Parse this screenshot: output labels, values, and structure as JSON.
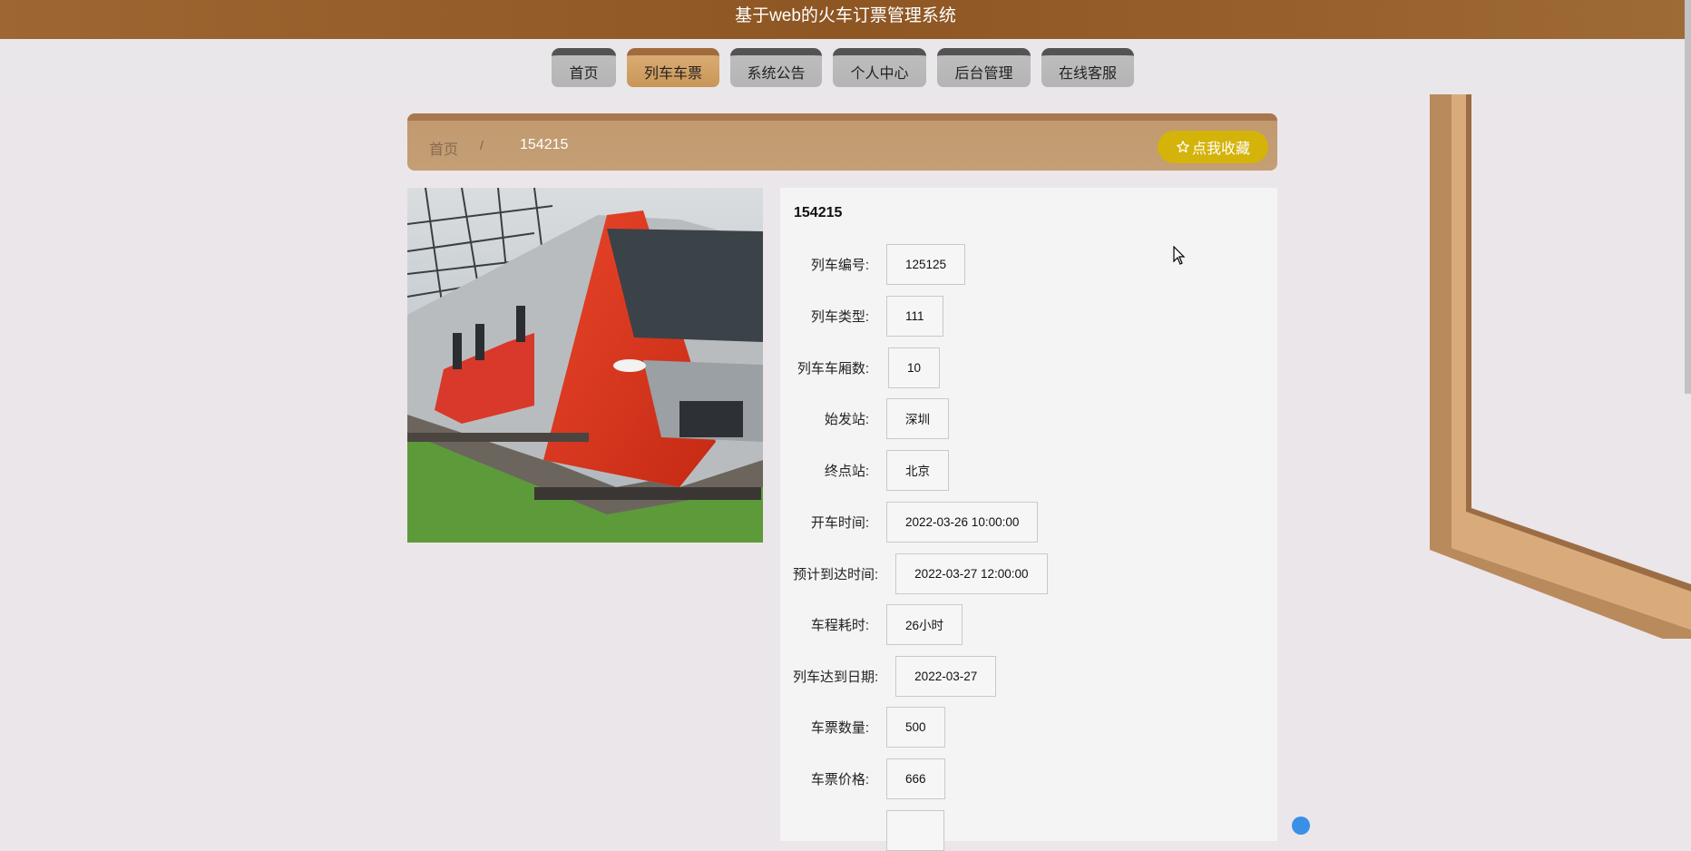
{
  "header": {
    "title": "基于web的火车订票管理系统"
  },
  "nav": [
    {
      "label": "首页"
    },
    {
      "label": "列车车票"
    },
    {
      "label": "系统公告"
    },
    {
      "label": "个人中心"
    },
    {
      "label": "后台管理"
    },
    {
      "label": "在线客服"
    }
  ],
  "nav_active_index": 1,
  "breadcrumb": {
    "home": "首页",
    "separator": "/",
    "current": "154215"
  },
  "favorite_button": {
    "icon": "star-outline-icon",
    "label": "点我收藏"
  },
  "detail": {
    "title": "154215",
    "fields": [
      {
        "label": "列车编号:",
        "value": "125125"
      },
      {
        "label": "列车类型:",
        "value": "111"
      },
      {
        "label": "列车车厢数:",
        "value": "10"
      },
      {
        "label": "始发站:",
        "value": "深圳"
      },
      {
        "label": "终点站:",
        "value": "北京"
      },
      {
        "label": "开车时间:",
        "value": "2022-03-26 10:00:00"
      },
      {
        "label": "预计到达时间:",
        "value": "2022-03-27 12:00:00"
      },
      {
        "label": "车程耗时:",
        "value": "26小时"
      },
      {
        "label": "列车达到日期:",
        "value": "2022-03-27"
      },
      {
        "label": "车票数量:",
        "value": "500"
      },
      {
        "label": "车票价格:",
        "value": "666"
      }
    ]
  },
  "colors": {
    "header": "#8e5623",
    "nav_active": "#d3a268",
    "favorite": "#d4b30a"
  }
}
